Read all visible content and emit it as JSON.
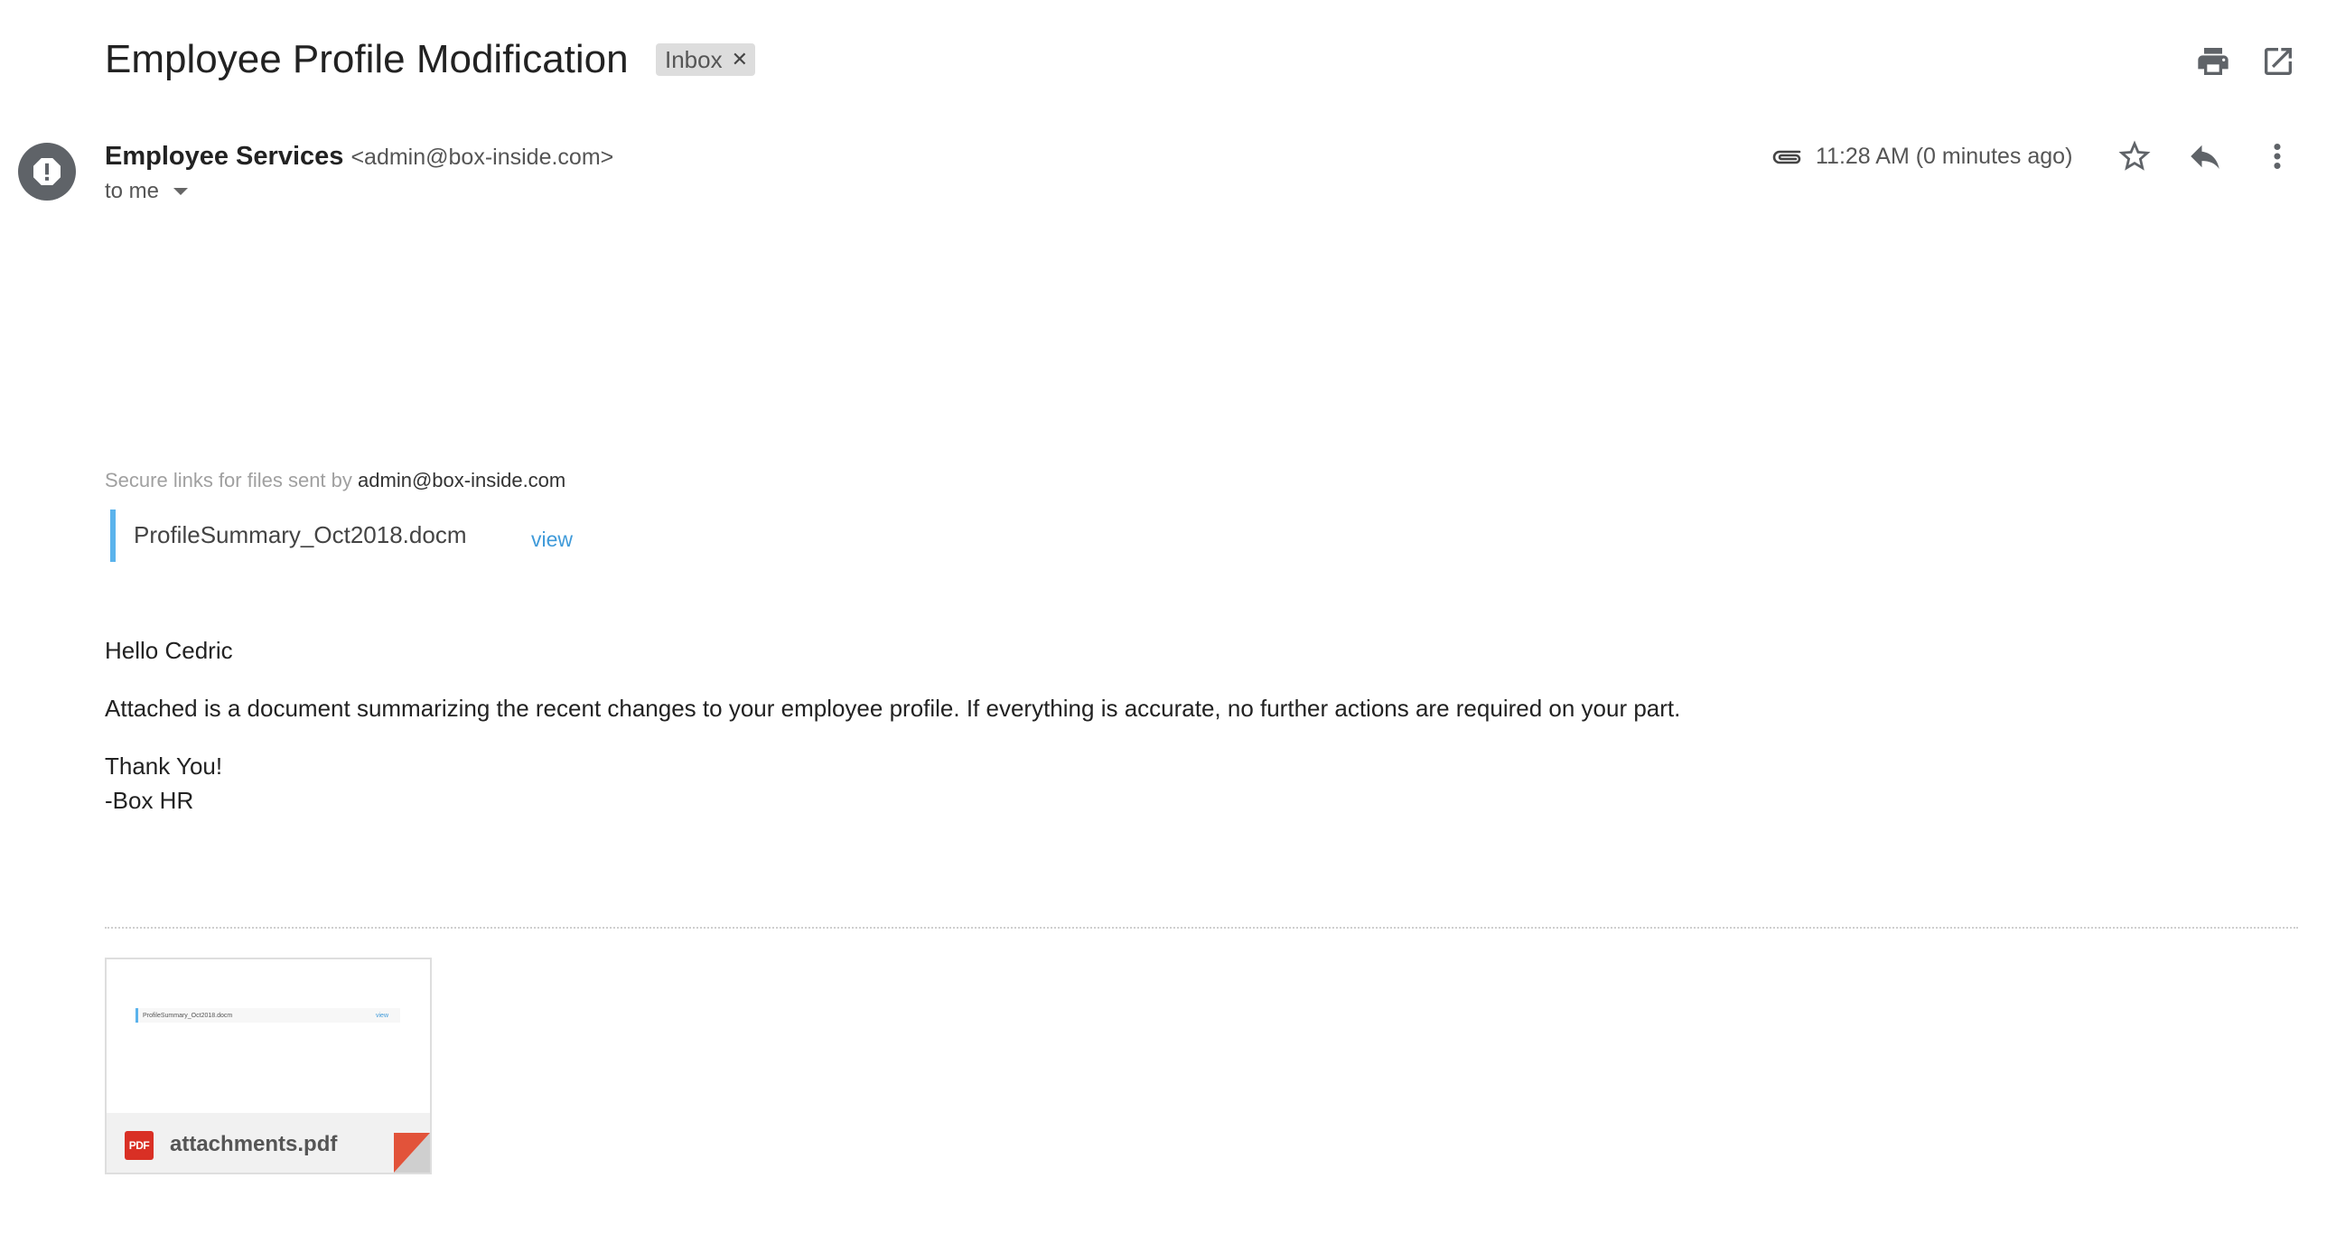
{
  "header": {
    "subject": "Employee Profile Modification",
    "label_chip": "Inbox",
    "print_icon": "print-icon",
    "open_new_window_icon": "open-in-new-window-icon"
  },
  "message": {
    "sender_name": "Employee Services",
    "sender_email": "<admin@box-inside.com>",
    "recipient": "to me",
    "timestamp": "11:28 AM (0 minutes ago)",
    "icons": {
      "attachment": "paperclip-icon",
      "star": "star-icon",
      "reply": "reply-icon",
      "more": "more-vert-icon",
      "avatar": "warning-icon"
    }
  },
  "body": {
    "secure_prefix": "Secure links for files sent by",
    "secure_email": "admin@box-inside.com",
    "file_name": "ProfileSummary_Oct2018.docm",
    "file_view": "view",
    "greeting": "Hello Cedric",
    "paragraph": "Attached is a document summarizing the recent changes to your employee profile. If everything is accurate, no further actions are required on your part.",
    "signoff": "Thank You!",
    "signature": "-Box HR"
  },
  "attachment": {
    "filename": "attachments.pdf",
    "type_badge": "PDF",
    "colors": {
      "pdf_red": "#d93025",
      "link_blue": "#3f9ad9",
      "file_bar": "#5bb3ec",
      "curl_red": "#e2533a"
    }
  }
}
